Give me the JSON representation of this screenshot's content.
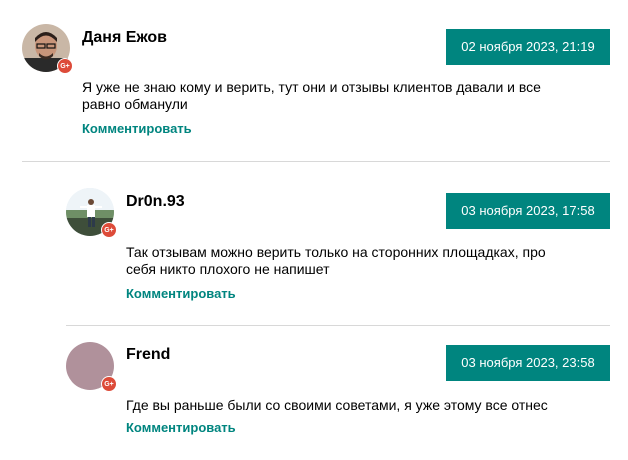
{
  "comments": [
    {
      "author": "Даня Ежов",
      "date": "02 ноября 2023, 21:19",
      "text": "Я уже не знаю кому и верить, тут они и отзывы клиентов давали и все равно обманули",
      "reply_label": "Комментировать",
      "badge": "G+"
    },
    {
      "author": "Dr0n.93",
      "date": "03 ноября 2023, 17:58",
      "text": "Так отзывам можно верить только на сторонних площадках, про себя никто плохого не напишет",
      "reply_label": "Комментировать",
      "badge": "G+"
    },
    {
      "author": "Frend",
      "date": "03 ноября 2023, 23:58",
      "text": "Где вы раньше были со своими советами, я уже этому все отнес",
      "reply_label": "Комментировать",
      "badge": "G+"
    }
  ],
  "colors": {
    "accent": "#00857f",
    "badge": "#dd4b39",
    "avatar_placeholder": "#b0919b"
  }
}
